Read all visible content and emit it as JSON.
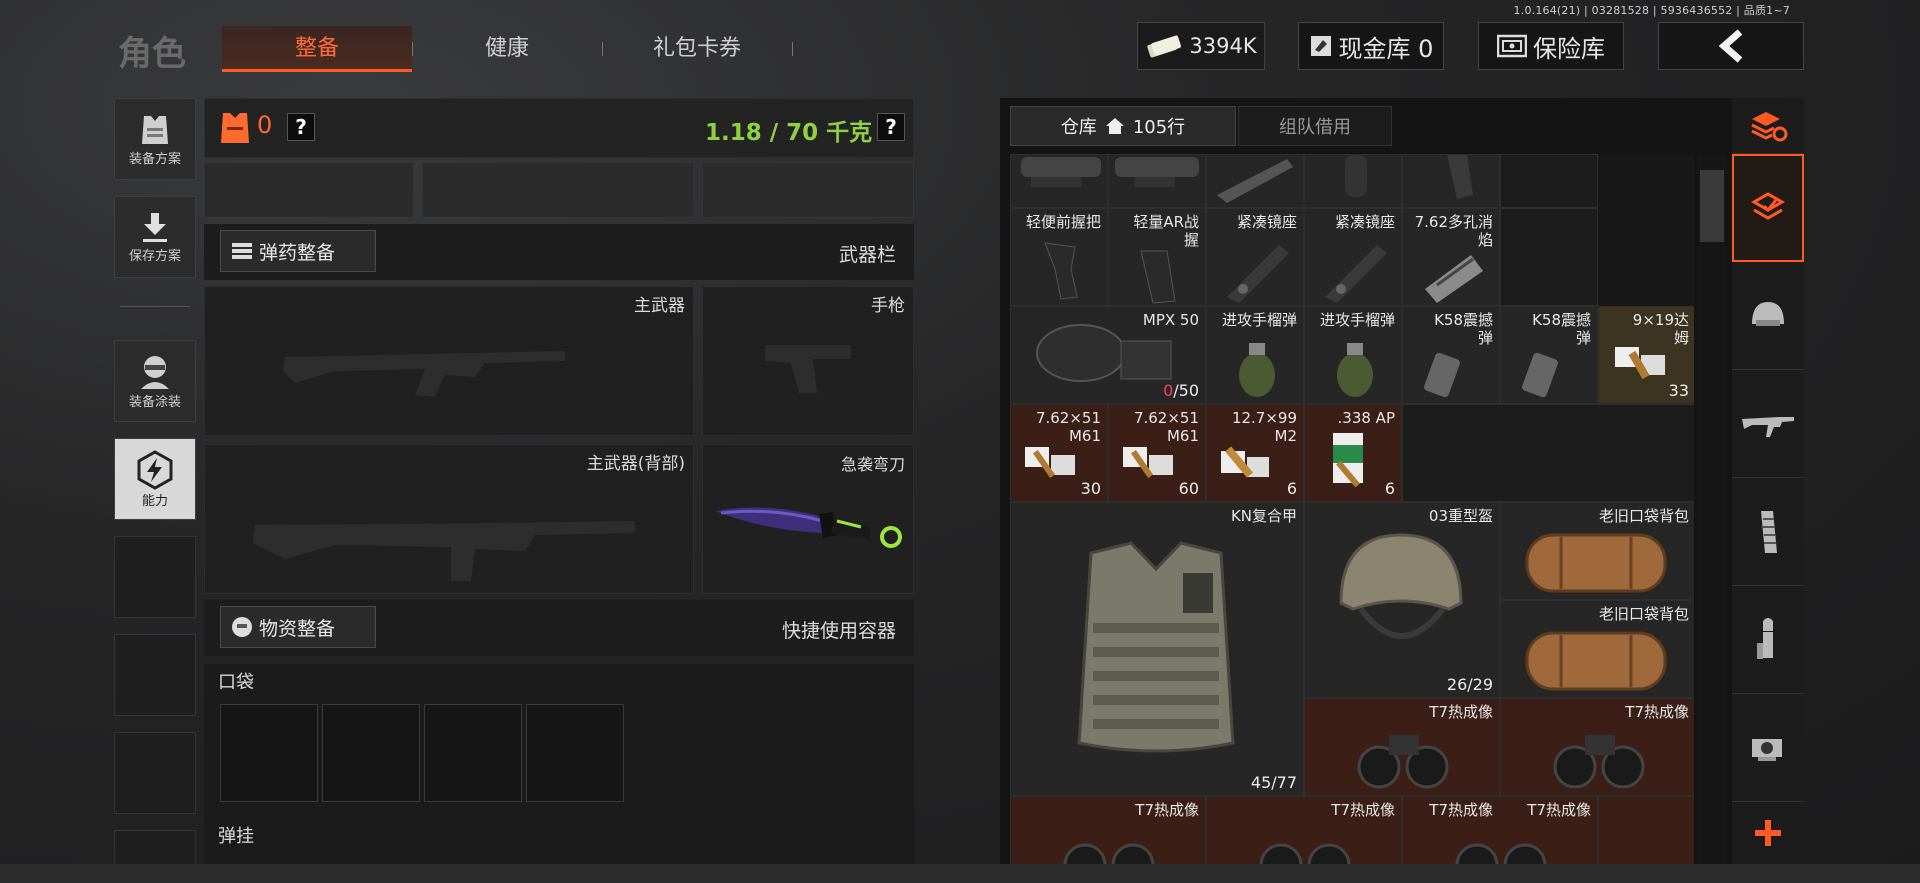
{
  "header": {
    "version": "1.0.164(21) | 03281528 | 5936436552 | 品质1~7",
    "title": "角色",
    "tabs": [
      {
        "label": "整备",
        "active": true
      },
      {
        "label": "健康",
        "active": false
      },
      {
        "label": "礼包卡券",
        "active": false
      }
    ],
    "money": "3394K",
    "cash_vault": "现金库 0",
    "safe": "保险库",
    "back_icon": "chevron-left-icon"
  },
  "left_sidebar": [
    {
      "label": "装备方案",
      "icon": "vest-icon"
    },
    {
      "label": "保存方案",
      "icon": "download-icon"
    },
    {
      "label": "装备涂装",
      "icon": "soldier-icon"
    },
    {
      "label": "能力",
      "icon": "lightning-icon",
      "active": true
    }
  ],
  "loadout": {
    "armor_count": "0",
    "weight": "1.18 / 70 千克",
    "weight_color": "#8fd13f",
    "ammo_button": "弹药整备",
    "weapon_bar": "武器栏",
    "primary": "主武器",
    "pistol": "手枪",
    "primary_back": "主武器(背部)",
    "melee": "急袭弯刀",
    "supplies_button": "物资整备",
    "quick_container": "快捷使用容器",
    "pocket": "口袋",
    "rig": "弹挂"
  },
  "storage": {
    "tab_warehouse": "仓库",
    "rows": "105行",
    "tab_team": "组队借用",
    "items": [
      {
        "name": "轻便前握把",
        "count": ""
      },
      {
        "name": "轻量AR战握",
        "count": ""
      },
      {
        "name": "紧凑镜座",
        "count": ""
      },
      {
        "name": "紧凑镜座",
        "count": ""
      },
      {
        "name": "7.62多孔消焰",
        "count": ""
      },
      {
        "name": "MPX 50",
        "count": "0/50"
      },
      {
        "name": "进攻手榴弹",
        "count": ""
      },
      {
        "name": "进攻手榴弹",
        "count": ""
      },
      {
        "name": "K58震撼弹",
        "count": ""
      },
      {
        "name": "K58震撼弹",
        "count": ""
      },
      {
        "name": "9×19达姆",
        "count": "33"
      },
      {
        "name": "7.62×51 M61",
        "count": "30"
      },
      {
        "name": "7.62×51 M61",
        "count": "60"
      },
      {
        "name": "12.7×99 M2",
        "count": "6"
      },
      {
        "name": ".338 AP",
        "count": "6"
      },
      {
        "name": "KN复合甲",
        "count": "45/77"
      },
      {
        "name": "03重型盔",
        "count": "26/29"
      },
      {
        "name": "老旧口袋背包",
        "count": ""
      },
      {
        "name": "老旧口袋背包",
        "count": ""
      },
      {
        "name": "T7热成像",
        "count": ""
      },
      {
        "name": "T7热成像",
        "count": ""
      },
      {
        "name": "T7热成像",
        "count": ""
      },
      {
        "name": "T7热成像",
        "count": ""
      },
      {
        "name": "T7热成像",
        "count": ""
      },
      {
        "name": "T7热成像",
        "count": ""
      }
    ]
  },
  "right_bar": [
    {
      "icon": "sort-icon"
    },
    {
      "icon": "storage-icon",
      "active": true
    },
    {
      "icon": "helmet-icon"
    },
    {
      "icon": "rifle-icon"
    },
    {
      "icon": "magazine-icon"
    },
    {
      "icon": "bullet-icon"
    },
    {
      "icon": "scope-icon"
    },
    {
      "icon": "plus-icon"
    }
  ],
  "colors": {
    "accent": "#ff5a24",
    "rare": "#3b1f16",
    "gold": "#3c3420"
  }
}
